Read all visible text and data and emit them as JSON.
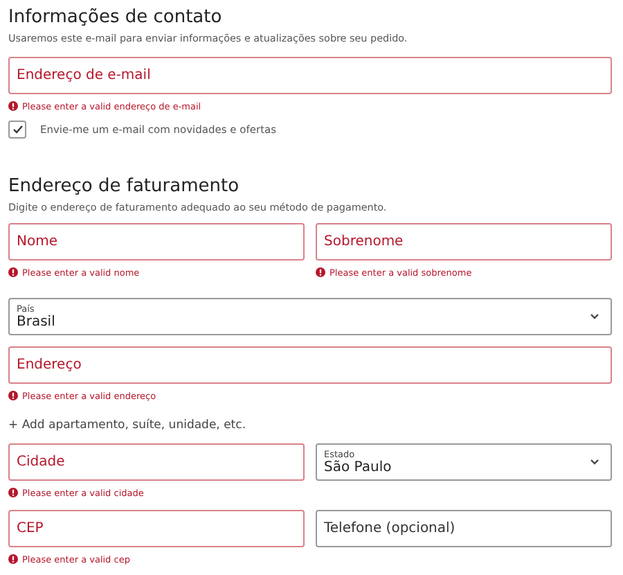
{
  "contact": {
    "title": "Informações de contato",
    "subtitle": "Usaremos este e-mail para enviar informações e atualizações sobre seu pedido.",
    "email": {
      "kind": "text",
      "placeholder": "Endereço de e-mail",
      "invalid": true,
      "error": "Please enter a valid endereço de e-mail"
    },
    "newsletter": {
      "label": "Envie-me um e-mail com novidades e ofertas",
      "checked": true
    }
  },
  "billing": {
    "title": "Endereço de faturamento",
    "subtitle": "Digite o endereço de faturamento adequado ao seu método de pagamento.",
    "items": [
      {
        "kind": "row",
        "fields": [
          {
            "kind": "text",
            "placeholder": "Nome",
            "invalid": true,
            "error": "Please enter a valid nome"
          },
          {
            "kind": "text",
            "placeholder": "Sobrenome",
            "invalid": true,
            "error": "Please enter a valid sobrenome"
          }
        ]
      },
      {
        "kind": "row",
        "fields": [
          {
            "kind": "select",
            "label": "País",
            "value": "Brasil",
            "invalid": false
          }
        ]
      },
      {
        "kind": "row",
        "fields": [
          {
            "kind": "text",
            "placeholder": "Endereço",
            "invalid": true,
            "error": "Please enter a valid endereço"
          }
        ]
      },
      {
        "kind": "link",
        "text": "+ Add apartamento, suíte, unidade, etc."
      },
      {
        "kind": "row",
        "fields": [
          {
            "kind": "text",
            "placeholder": "Cidade",
            "invalid": true,
            "error": "Please enter a valid cidade"
          },
          {
            "kind": "select",
            "label": "Estado",
            "value": "São Paulo",
            "invalid": false
          }
        ]
      },
      {
        "kind": "row",
        "fields": [
          {
            "kind": "text",
            "placeholder": "CEP",
            "invalid": true,
            "error": "Please enter a valid cep"
          },
          {
            "kind": "text",
            "placeholder": "Telefone (opcional)",
            "invalid": false
          }
        ]
      }
    ]
  }
}
